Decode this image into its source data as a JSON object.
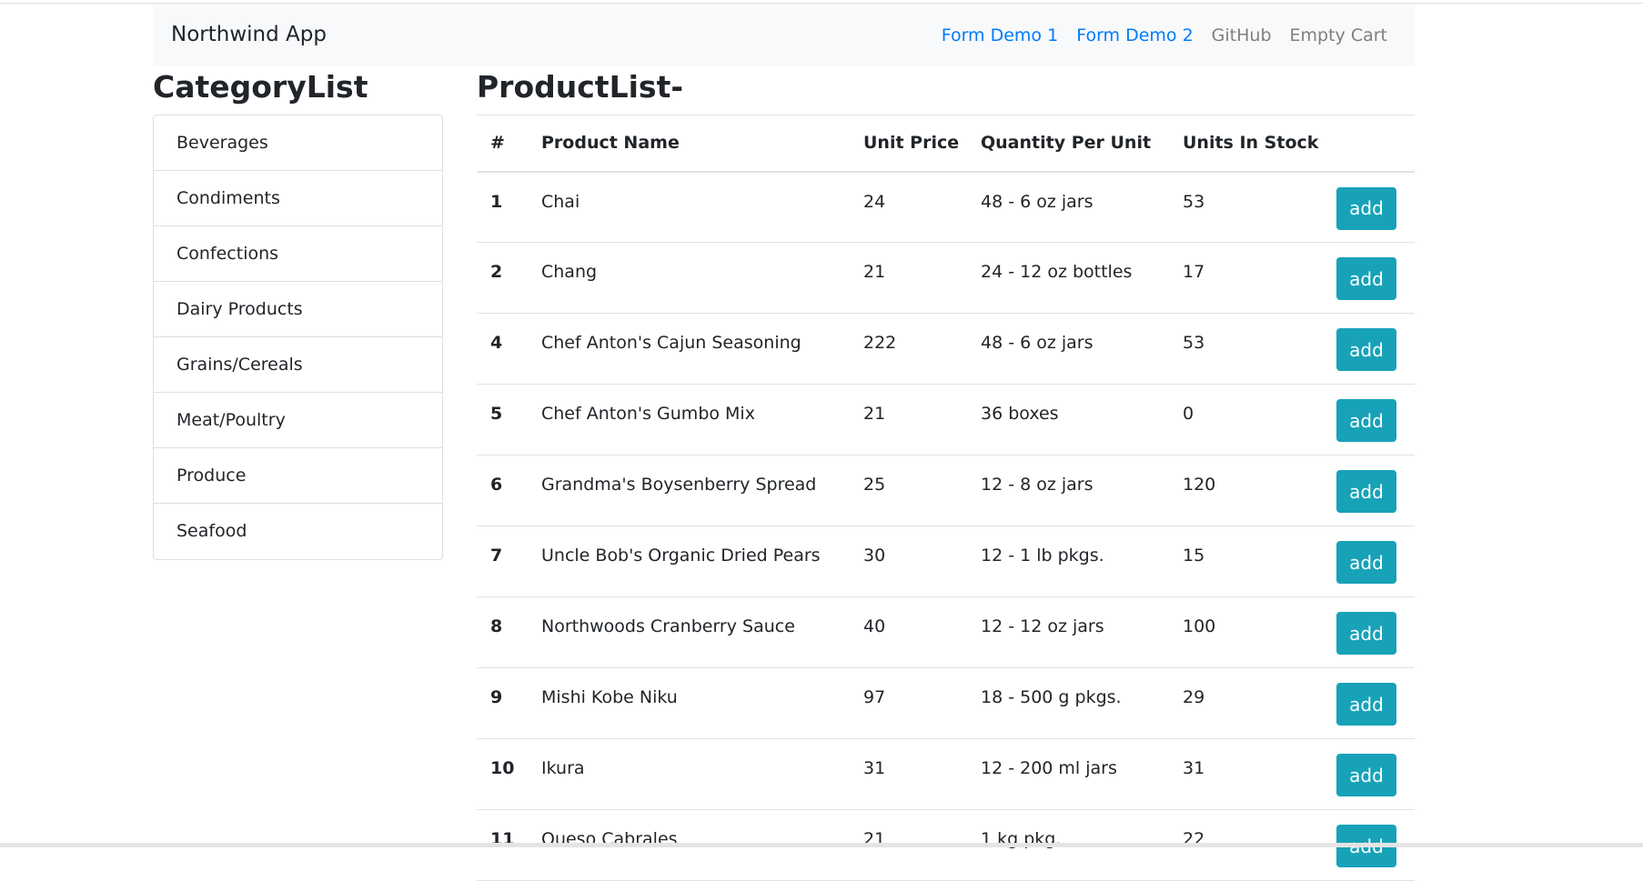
{
  "navbar": {
    "brand": "Northwind App",
    "links": [
      {
        "label": "Form Demo 1"
      },
      {
        "label": "Form Demo 2"
      },
      {
        "label": "GitHub"
      },
      {
        "label": "Empty Cart"
      }
    ]
  },
  "categories": {
    "title": "CategoryList",
    "items": [
      {
        "label": "Beverages"
      },
      {
        "label": "Condiments"
      },
      {
        "label": "Confections"
      },
      {
        "label": "Dairy Products"
      },
      {
        "label": "Grains/Cereals"
      },
      {
        "label": "Meat/Poultry"
      },
      {
        "label": "Produce"
      },
      {
        "label": "Seafood"
      }
    ]
  },
  "products": {
    "title": "ProductList-",
    "columns": [
      "#",
      "Product Name",
      "Unit Price",
      "Quantity Per Unit",
      "Units In Stock"
    ],
    "add_label": "add",
    "rows": [
      {
        "id": "1",
        "name": "Chai",
        "price": "24",
        "qty": "48 - 6 oz jars",
        "stock": "53"
      },
      {
        "id": "2",
        "name": "Chang",
        "price": "21",
        "qty": "24 - 12 oz bottles",
        "stock": "17"
      },
      {
        "id": "4",
        "name": "Chef Anton's Cajun Seasoning",
        "price": "222",
        "qty": "48 - 6 oz jars",
        "stock": "53"
      },
      {
        "id": "5",
        "name": "Chef Anton's Gumbo Mix",
        "price": "21",
        "qty": "36 boxes",
        "stock": "0"
      },
      {
        "id": "6",
        "name": "Grandma's Boysenberry Spread",
        "price": "25",
        "qty": "12 - 8 oz jars",
        "stock": "120"
      },
      {
        "id": "7",
        "name": "Uncle Bob's Organic Dried Pears",
        "price": "30",
        "qty": "12 - 1 lb pkgs.",
        "stock": "15"
      },
      {
        "id": "8",
        "name": "Northwoods Cranberry Sauce",
        "price": "40",
        "qty": "12 - 12 oz jars",
        "stock": "100"
      },
      {
        "id": "9",
        "name": "Mishi Kobe Niku",
        "price": "97",
        "qty": "18 - 500 g pkgs.",
        "stock": "29"
      },
      {
        "id": "10",
        "name": "Ikura",
        "price": "31",
        "qty": "12 - 200 ml jars",
        "stock": "31"
      },
      {
        "id": "11",
        "name": "Queso Cabrales",
        "price": "21",
        "qty": "1 kg pkg.",
        "stock": "22"
      }
    ]
  }
}
